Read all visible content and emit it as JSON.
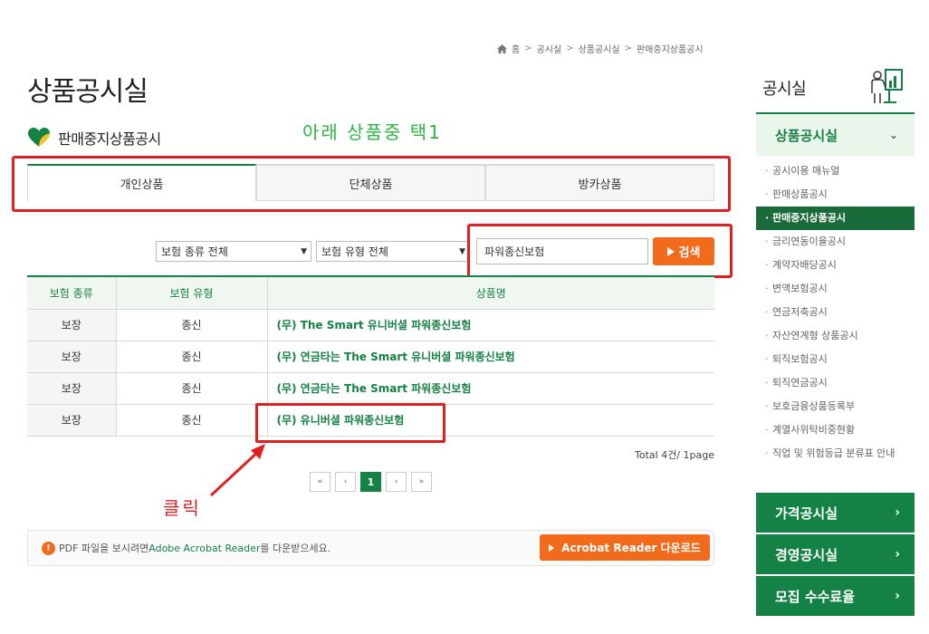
{
  "breadcrumb": [
    "홈",
    "공시실",
    "상품공시실",
    "판매중지상품공시"
  ],
  "page_title": "상품공시실",
  "section_title": "판매중지상품공시",
  "annotations": {
    "tab_hint": "아래 상품중 택1",
    "click_hint": "클릭"
  },
  "tabs": [
    {
      "label": "개인상품",
      "active": true
    },
    {
      "label": "단체상품",
      "active": false
    },
    {
      "label": "방카상품",
      "active": false
    }
  ],
  "filters": {
    "type_select": "보험 종류 전체",
    "kind_select": "보험 유형 전체",
    "search_value": "파워종신보험",
    "search_button": "검색"
  },
  "table": {
    "headers": [
      "보험 종류",
      "보험 유형",
      "상품명"
    ],
    "rows": [
      [
        "보장",
        "종신",
        "(무) The Smart 유니버셜 파워종신보험"
      ],
      [
        "보장",
        "종신",
        "(무) 연금타는 The Smart 유니버셜 파워종신보험"
      ],
      [
        "보장",
        "종신",
        "(무) 연금타는 The Smart 파워종신보험"
      ],
      [
        "보장",
        "종신",
        "(무) 유니버셜 파워종신보험"
      ]
    ]
  },
  "total": "Total 4건/ 1page",
  "pagination": {
    "first": "«",
    "prev": "‹",
    "current": "1",
    "next": "›",
    "last": "»"
  },
  "pdf_notice": {
    "icon": "!",
    "pre": "PDF 파일을 보시려면 ",
    "link": "Adobe Acrobat Reader",
    "post": "를 다운받으세요.",
    "button": "Acrobat Reader 다운로드"
  },
  "sidebar": {
    "title": "공시실",
    "current_section": "상품공시실",
    "items": [
      {
        "label": "공시이용 매뉴얼",
        "active": false
      },
      {
        "label": "판매상품공시",
        "active": false
      },
      {
        "label": "판매중지상품공시",
        "active": true
      },
      {
        "label": "금리연동이율공시",
        "active": false
      },
      {
        "label": "계약자배당공시",
        "active": false
      },
      {
        "label": "변액보험공시",
        "active": false
      },
      {
        "label": "연금저축공시",
        "active": false
      },
      {
        "label": "자산연계형 상품공시",
        "active": false
      },
      {
        "label": "퇴직보험공시",
        "active": false
      },
      {
        "label": "퇴직연금공시",
        "active": false
      },
      {
        "label": "보호금융상품등록부",
        "active": false
      },
      {
        "label": "계열사위탁비중현황",
        "active": false
      },
      {
        "label": "직업 및 위험등급 분류표 안내",
        "active": false
      }
    ],
    "sections": [
      "가격공시실",
      "경영공시실",
      "모집 수수료율"
    ]
  },
  "colors": {
    "brand_green": "#148244",
    "accent_orange": "#f26b1d",
    "annotation_red": "#e02020",
    "annotation_green": "#2db742"
  }
}
